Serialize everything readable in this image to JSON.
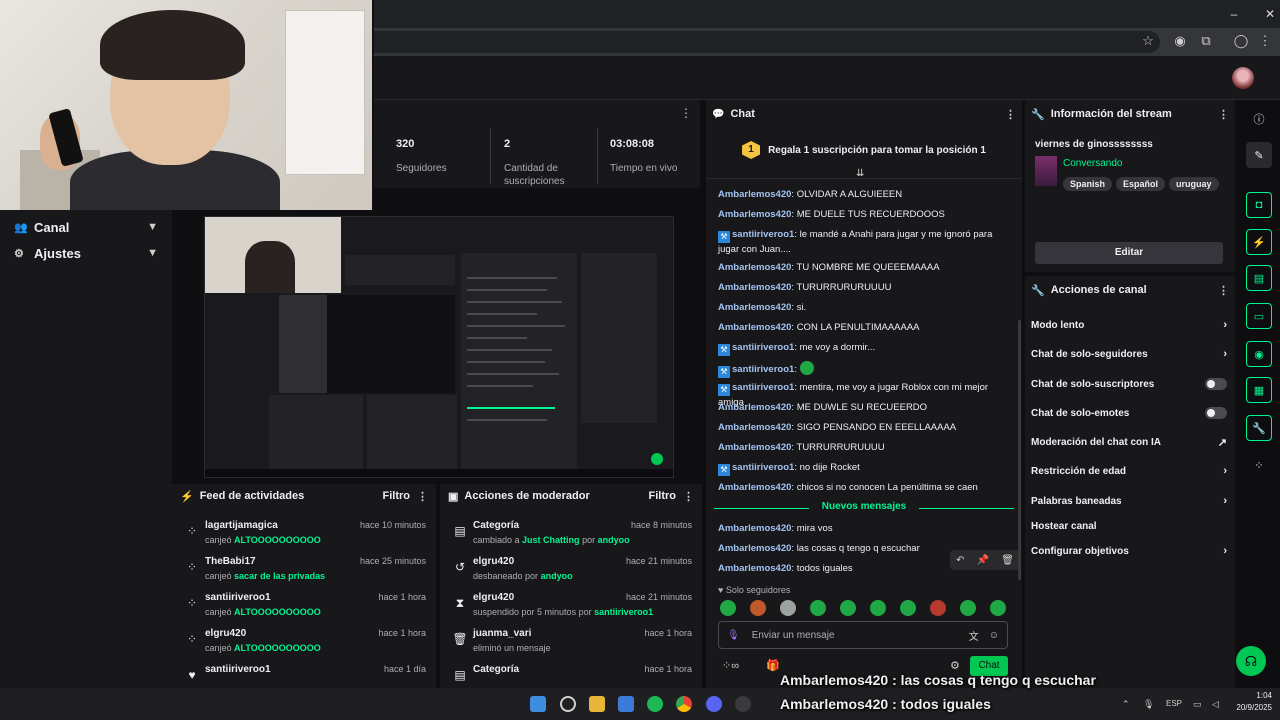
{
  "stats": [
    {
      "value": "320",
      "label": "Seguidores"
    },
    {
      "value": "2",
      "label": "Cantidad de suscripciones"
    },
    {
      "value": "03:08:08",
      "label": "Tiempo en vivo"
    }
  ],
  "sidebar": {
    "items": [
      {
        "label": "Canal",
        "icon": "users-icon"
      },
      {
        "label": "Ajustes",
        "icon": "gear-icon"
      }
    ]
  },
  "feed": {
    "title": "Feed de actividades",
    "filter_label": "Filtro",
    "items": [
      {
        "user": "lagartijamagica",
        "time": "hace 10 minutos",
        "prefix": "canjeó",
        "highlight": "ALTOOOOOOOOOO",
        "suffix": ""
      },
      {
        "user": "TheBabi17",
        "time": "hace 25 minutos",
        "prefix": "canjeó",
        "highlight": "sacar de las privadas",
        "suffix": ""
      },
      {
        "user": "santiiriveroo1",
        "time": "hace 1 hora",
        "prefix": "canjeó",
        "highlight": "ALTOOOOOOOOOO",
        "suffix": ""
      },
      {
        "user": "elgru420",
        "time": "hace 1 hora",
        "prefix": "canjeó",
        "highlight": "ALTOOOOOOOOOO",
        "suffix": ""
      },
      {
        "user": "santiiriveroo1",
        "time": "hace 1 día",
        "prefix": "",
        "highlight": "",
        "suffix": ""
      }
    ]
  },
  "modactions": {
    "title": "Acciones de moderador",
    "filter_label": "Filtro",
    "items": [
      {
        "who": "Categoría",
        "time": "hace 8 minutos",
        "line": "cambiado a",
        "target": "Just Chatting",
        "by": "por",
        "mod": "andyoo"
      },
      {
        "who": "elgru420",
        "time": "hace 21 minutos",
        "line": "desbaneado por",
        "target": "",
        "by": "",
        "mod": "andyoo"
      },
      {
        "who": "elgru420",
        "time": "hace 21 minutos",
        "line": "suspendido por 5 minutos por",
        "target": "",
        "by": "",
        "mod": "santiiriveroo1"
      },
      {
        "who": "juanma_vari",
        "time": "hace 1 hora",
        "line": "eliminó un mensaje",
        "target": "",
        "by": "",
        "mod": ""
      },
      {
        "who": "Categoría",
        "time": "hace 1 hora",
        "line": "",
        "target": "",
        "by": "",
        "mod": ""
      }
    ]
  },
  "chat": {
    "title": "Chat",
    "pinned": "Regala 1 suscripción para tomar la posición 1",
    "pin_rank": "1",
    "messages": [
      {
        "user": "Ambarlemos420",
        "text": "OLVIDAR A ALGUIEEEN",
        "badge": false
      },
      {
        "user": "Ambarlemos420",
        "text": "ME DUELE TUS RECUERDOOOS",
        "badge": false
      },
      {
        "user": "santiiriveroo1",
        "text": "le mandé a Anahi para jugar y me ignoró para jugar con Juan....",
        "badge": true
      },
      {
        "user": "Ambarlemos420",
        "text": "TU NOMBRE ME QUEEEMAAAA",
        "badge": false
      },
      {
        "user": "Ambarlemos420",
        "text": "TURURRURURUUUU",
        "badge": false
      },
      {
        "user": "Ambarlemos420",
        "text": "si.",
        "badge": false
      },
      {
        "user": "Ambarlemos420",
        "text": "CON LA PENULTIMAAAAAA",
        "badge": false
      },
      {
        "user": "santiiriveroo1",
        "text": "me voy a dormir...",
        "badge": true
      },
      {
        "user": "santiiriveroo1",
        "text": "",
        "badge": true
      },
      {
        "user": "santiiriveroo1",
        "text": "mentira, me voy a jugar Roblox con mi mejor amiga",
        "badge": true
      },
      {
        "user": "Ambarlemos420",
        "text": "ME DUWLE SU RECUEERDO",
        "badge": false
      },
      {
        "user": "Ambarlemos420",
        "text": "SIGO PENSANDO EN EEELLAAAAA",
        "badge": false
      },
      {
        "user": "Ambarlemos420",
        "text": "TURRURRURUUUU",
        "badge": false
      },
      {
        "user": "santiiriveroo1",
        "text": "no dije Rocket",
        "badge": true
      },
      {
        "user": "Ambarlemos420",
        "text": "chicos si no conocen La penúltima se caen",
        "badge": false
      }
    ],
    "new_messages_label": "Nuevos mensajes",
    "new_messages": [
      {
        "user": "Ambarlemos420",
        "text": "mira vos"
      },
      {
        "user": "Ambarlemos420",
        "text": "las cosas q tengo q escuchar"
      },
      {
        "user": "Ambarlemos420",
        "text": "todos iguales"
      }
    ],
    "followers_only": "Solo seguidores",
    "input_placeholder": "Enviar un mensaje",
    "send_label": "Chat"
  },
  "info": {
    "title": "Información del stream",
    "stream_title": "viernes de ginossssssss",
    "category": "Conversando",
    "tags": [
      "Spanish",
      "Español",
      "uruguay"
    ],
    "edit_label": "Editar"
  },
  "actions": {
    "title": "Acciones de canal",
    "items": [
      {
        "label": "Modo lento",
        "kind": "chevron"
      },
      {
        "label": "Chat de solo-seguidores",
        "kind": "chevron"
      },
      {
        "label": "Chat de solo-suscriptores",
        "kind": "toggle"
      },
      {
        "label": "Chat de solo-emotes",
        "kind": "toggle"
      },
      {
        "label": "Moderación del chat con IA",
        "kind": "external"
      },
      {
        "label": "Restricción de edad",
        "kind": "chevron"
      },
      {
        "label": "Palabras baneadas",
        "kind": "chevron"
      },
      {
        "label": "Hostear canal",
        "kind": "none"
      },
      {
        "label": "Configurar objetivos",
        "kind": "chevron"
      }
    ]
  },
  "overlay": [
    {
      "user": "Ambarlemos420",
      "text": ": las cosas q tengo q escuchar"
    },
    {
      "user": "Ambarlemos420",
      "text": ": todos iguales"
    }
  ],
  "tray": {
    "lang": "ESP",
    "time": "1:04",
    "date": "20/9/2025"
  },
  "colors": {
    "accent": "#00f593",
    "background": "#0e0e10",
    "panel": "#18181b",
    "username": "#a3c4f3"
  }
}
